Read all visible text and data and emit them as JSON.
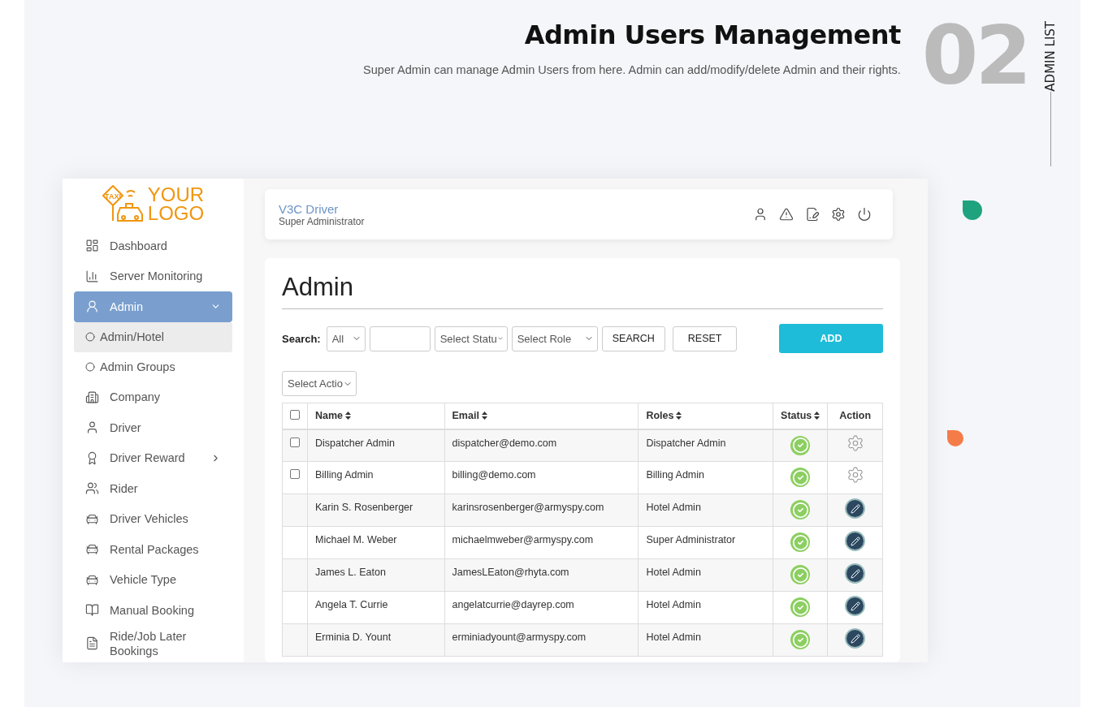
{
  "header": {
    "title": "Admin Users Management",
    "subtitle": "Super Admin can manage Admin Users from here. Admin can add/modify/delete Admin and their rights.",
    "number": "02",
    "section_label": "ADMIN LIST"
  },
  "app": {
    "logo": {
      "line_1": "YOUR",
      "line_2": "LOGO",
      "sign": "TAXI"
    },
    "sidebar": {
      "items": [
        {
          "label": "Dashboard",
          "selected": false
        },
        {
          "label": "Server Monitoring",
          "selected": false
        },
        {
          "label": "Admin",
          "selected": true,
          "expanded": true,
          "children": [
            {
              "label": "Admin/Hotel",
              "selected": true
            },
            {
              "label": "Admin Groups",
              "selected": false
            }
          ]
        },
        {
          "label": "Company",
          "selected": false
        },
        {
          "label": "Driver",
          "selected": false
        },
        {
          "label": "Driver Reward",
          "selected": false,
          "expanded": false
        },
        {
          "label": "Rider",
          "selected": false
        },
        {
          "label": "Driver Vehicles",
          "selected": false
        },
        {
          "label": "Rental Packages",
          "selected": false
        },
        {
          "label": "Vehicle Type",
          "selected": false
        },
        {
          "label": "Manual Booking",
          "selected": false
        },
        {
          "label": "Ride/Job Later Bookings",
          "selected": false
        }
      ]
    },
    "topbar": {
      "user_name": "V3C Driver",
      "user_role": "Super Administrator"
    },
    "page_title": "Admin",
    "filters": {
      "search_label": "Search:",
      "type_select": "All",
      "status_select": "Select Statu",
      "role_select": "Select Role",
      "search_button": "SEARCH",
      "reset_button": "RESET",
      "add_button": "ADD",
      "action_select": "Select Actio"
    },
    "table": {
      "select_all": {
        "checked": false
      },
      "columns": [
        {
          "label": "Name",
          "sortable": true
        },
        {
          "label": "Email",
          "sortable": true
        },
        {
          "label": "Roles",
          "sortable": true
        },
        {
          "label": "Status",
          "sortable": true
        },
        {
          "label": "Action",
          "sortable": false
        }
      ],
      "rows": [
        {
          "kind": "checkbox",
          "checked": false,
          "name": "Dispatcher Admin",
          "email": "dispatcher@demo.com",
          "role": "Dispatcher Admin",
          "active": true,
          "editable": false
        },
        {
          "kind": "checkbox",
          "checked": false,
          "name": "Billing Admin",
          "email": "billing@demo.com",
          "role": "Billing Admin",
          "active": true,
          "editable": false
        },
        {
          "kind": "plain",
          "name": "Karin S. Rosenberger",
          "email": "karinsrosenberger@armyspy.com",
          "role": "Hotel Admin",
          "active": true,
          "editable": true
        },
        {
          "kind": "plain",
          "name": "Michael M. Weber",
          "email": "michaelmweber@armyspy.com",
          "role": "Super Administrator",
          "active": true,
          "editable": true
        },
        {
          "kind": "plain",
          "name": "James L. Eaton",
          "email": "JamesLEaton@rhyta.com",
          "role": "Hotel Admin",
          "active": true,
          "editable": true
        },
        {
          "kind": "plain",
          "name": "Angela T. Currie",
          "email": "angelatcurrie@dayrep.com",
          "role": "Hotel Admin",
          "active": true,
          "editable": true
        },
        {
          "kind": "plain",
          "name": "Erminia D. Yount",
          "email": "erminiadyount@armyspy.com",
          "role": "Hotel Admin",
          "active": true,
          "editable": true
        }
      ]
    }
  }
}
